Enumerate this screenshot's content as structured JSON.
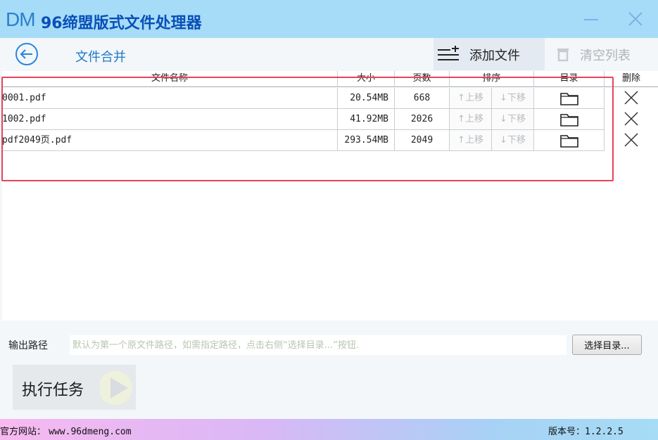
{
  "app": {
    "logo": "DM",
    "title": "96缔盟版式文件处理器"
  },
  "toolbar": {
    "page_title": "文件合并",
    "add_label": "添加文件",
    "clear_label": "清空列表"
  },
  "table": {
    "headers": {
      "name": "文件名称",
      "size": "大小",
      "pages": "页数",
      "order": "排序",
      "dir": "目录",
      "del": "删除"
    },
    "move_up": "↑上移",
    "move_down": "↓下移",
    "rows": [
      {
        "name": "0001.pdf",
        "size": "20.54MB",
        "pages": "668"
      },
      {
        "name": "1002.pdf",
        "size": "41.92MB",
        "pages": "2026"
      },
      {
        "name": "pdf2049页.pdf",
        "size": "293.54MB",
        "pages": "2049"
      }
    ]
  },
  "output": {
    "label": "输出路径",
    "placeholder": "默认为第一个原文件路径，如需指定路径，点击右侧“选择目录...”按钮.",
    "choose_label": "选择目录..."
  },
  "run": {
    "label": "执行任务"
  },
  "footer": {
    "site_label": "官方网站：",
    "site_url": "www.96dmeng.com",
    "version_label": "版本号：",
    "version": "1.2.2.5"
  },
  "colors": {
    "titlebar": "#a6dcf7",
    "accent": "#1e78c8",
    "selection": "#e8425c"
  }
}
